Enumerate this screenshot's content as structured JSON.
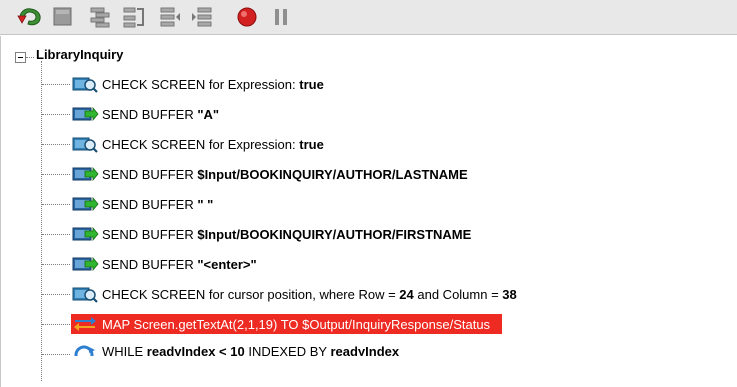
{
  "toolbar": {
    "buttons": [
      {
        "name": "green-back-icon"
      },
      {
        "name": "stop-square-icon"
      },
      {
        "name": "step-into-icon"
      },
      {
        "name": "step-over-icon"
      },
      {
        "name": "step-out-icon"
      },
      {
        "name": "record-red-icon"
      },
      {
        "name": "pause-icon"
      }
    ]
  },
  "tree": {
    "root_label": "LibraryInquiry",
    "items": [
      {
        "icon": "check-screen-icon",
        "text": "CHECK SCREEN for Expression: ",
        "bold": "true",
        "rest": ""
      },
      {
        "icon": "send-buffer-icon",
        "text": "SEND BUFFER ",
        "bold": "\"A\"",
        "rest": ""
      },
      {
        "icon": "check-screen-icon",
        "text": "CHECK SCREEN for Expression: ",
        "bold": "true",
        "rest": ""
      },
      {
        "icon": "send-buffer-icon",
        "text": "SEND BUFFER ",
        "bold": "$Input/BOOKINQUIRY/AUTHOR/LASTNAME",
        "rest": ""
      },
      {
        "icon": "send-buffer-icon",
        "text": "SEND BUFFER ",
        "bold": "\" \"",
        "rest": ""
      },
      {
        "icon": "send-buffer-icon",
        "text": "SEND BUFFER ",
        "bold": "$Input/BOOKINQUIRY/AUTHOR/FIRSTNAME",
        "rest": ""
      },
      {
        "icon": "send-buffer-icon",
        "text": "SEND BUFFER ",
        "bold": "\"<enter>\"",
        "rest": ""
      },
      {
        "icon": "check-screen-icon",
        "text": "CHECK SCREEN for cursor position, where Row = ",
        "bold": "24",
        "rest": " and Column = ",
        "bold2": "38"
      },
      {
        "icon": "map-icon",
        "text": "MAP Screen.getTextAt(2,1,19) TO $Output/InquiryResponse/Status",
        "bold": "",
        "rest": "",
        "selected": true
      },
      {
        "icon": "while-loop-icon",
        "text": "WHILE ",
        "bold": "readyIndex < 10",
        "rest": " INDEXED BY ",
        "bold2": "readyIndex",
        "partial": true
      }
    ]
  },
  "colors": {
    "selection": "#ee2b22",
    "toolbar_bg": "#e8e8e8"
  }
}
